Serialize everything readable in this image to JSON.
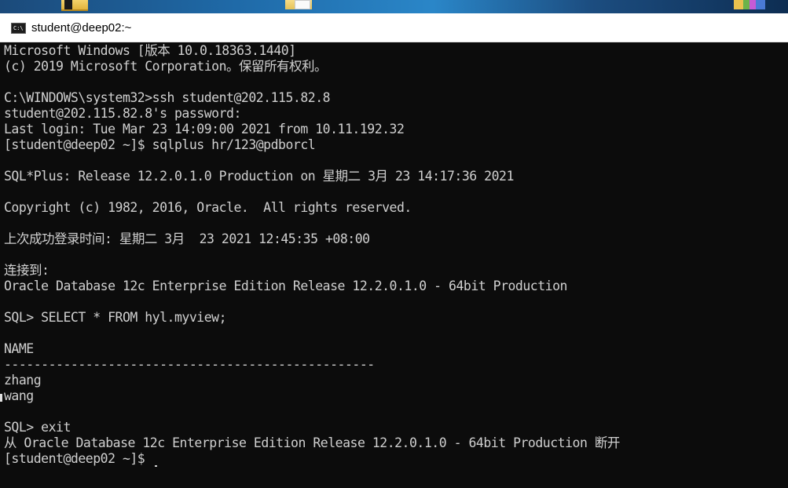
{
  "window": {
    "title": "student@deep02:~",
    "icon_glyph": "C:\\"
  },
  "desktop": {
    "icons": [
      "folder-icon",
      "folder-icon",
      "app-icon"
    ]
  },
  "console": {
    "lines": [
      "Microsoft Windows [版本 10.0.18363.1440]",
      "(c) 2019 Microsoft Corporation。保留所有权利。",
      "",
      "C:\\WINDOWS\\system32>ssh student@202.115.82.8",
      "student@202.115.82.8's password:",
      "Last login: Tue Mar 23 14:09:00 2021 from 10.11.192.32",
      "[student@deep02 ~]$ sqlplus hr/123@pdborcl",
      "",
      "SQL*Plus: Release 12.2.0.1.0 Production on 星期二 3月 23 14:17:36 2021",
      "",
      "Copyright (c) 1982, 2016, Oracle.  All rights reserved.",
      "",
      "上次成功登录时间: 星期二 3月  23 2021 12:45:35 +08:00",
      "",
      "连接到:",
      "Oracle Database 12c Enterprise Edition Release 12.2.0.1.0 - 64bit Production",
      "",
      "SQL> SELECT * FROM hyl.myview;",
      "",
      "NAME",
      "--------------------------------------------------",
      "zhang",
      "wang",
      "",
      "SQL> exit",
      "从 Oracle Database 12c Enterprise Edition Release 12.2.0.1.0 - 64bit Production 断开",
      "[student@deep02 ~]$"
    ]
  },
  "colors": {
    "console_bg": "#0c0c0c",
    "console_fg": "#d0d0d0",
    "titlebar_bg": "#ffffff"
  }
}
